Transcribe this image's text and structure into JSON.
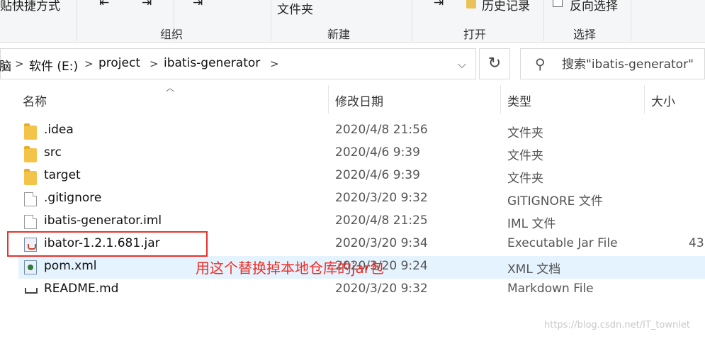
{
  "ribbon": {
    "groups": [
      "组织",
      "新建",
      "打开",
      "选择"
    ],
    "clipped_items": [
      "贴快捷方式",
      "文件夹",
      "历史记录",
      "反向选择"
    ]
  },
  "address": {
    "crumbs": [
      "脑",
      "软件 (E:)",
      "project",
      "ibatis-generator"
    ],
    "separator": ">"
  },
  "search": {
    "placeholder": "搜索\"ibatis-generator\""
  },
  "columns": {
    "name": "名称",
    "date": "修改日期",
    "type": "类型",
    "size": "大小"
  },
  "files": [
    {
      "name": ".idea",
      "date": "2020/4/8 21:56",
      "type": "文件夹",
      "size": "",
      "icon": "folder-icon"
    },
    {
      "name": "src",
      "date": "2020/4/6 9:39",
      "type": "文件夹",
      "size": "",
      "icon": "folder-icon"
    },
    {
      "name": "target",
      "date": "2020/4/6 9:39",
      "type": "文件夹",
      "size": "",
      "icon": "folder-icon"
    },
    {
      "name": ".gitignore",
      "date": "2020/3/20 9:32",
      "type": "GITIGNORE 文件",
      "size": "",
      "icon": "file-icon"
    },
    {
      "name": "ibatis-generator.iml",
      "date": "2020/4/8 21:25",
      "type": "IML 文件",
      "size": "",
      "icon": "file-icon"
    },
    {
      "name": "ibator-1.2.1.681.jar",
      "date": "2020/3/20 9:34",
      "type": "Executable Jar File",
      "size": "43",
      "icon": "jar-icon"
    },
    {
      "name": "pom.xml",
      "date": "2020/3/20 9:24",
      "type": "XML 文档",
      "size": "",
      "icon": "xml-icon"
    },
    {
      "name": "README.md",
      "date": "2020/3/20 9:32",
      "type": "Markdown File",
      "size": "",
      "icon": "markdown-icon"
    }
  ],
  "annotation": "用这个替换掉本地仓库的jar包",
  "watermark": "https://blog.csdn.net/IT_townlet",
  "colors": {
    "highlight": "#e5f3ff",
    "annotation": "#f02b23",
    "folder": "#f4c34a"
  }
}
